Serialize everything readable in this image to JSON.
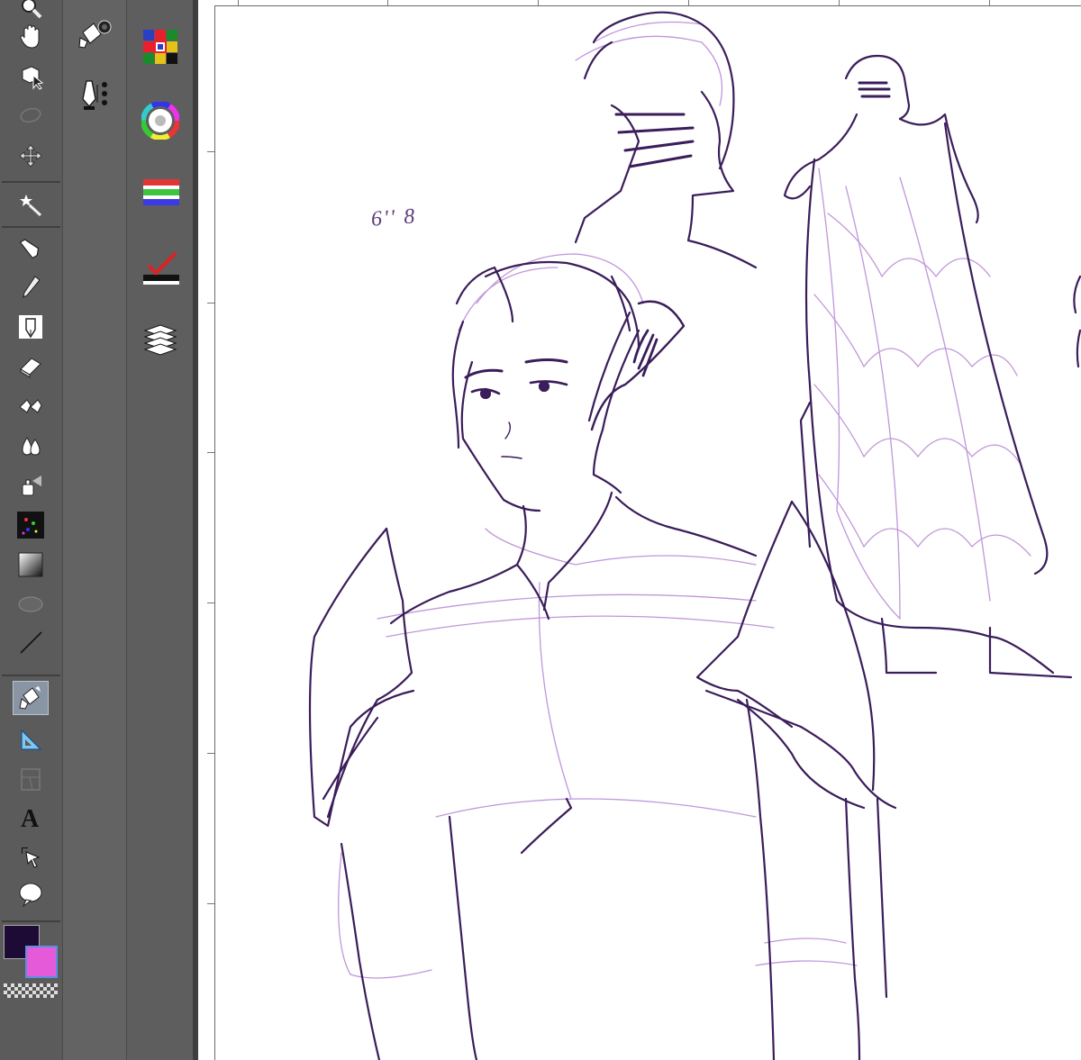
{
  "app": {
    "colors": {
      "main_color": "#1d0a35",
      "sub_color": "#e55ad9",
      "line_dark": "#3a1d5a",
      "line_light": "#b98bd6"
    }
  },
  "toolbar": {
    "tools": [
      {
        "name": "zoom-icon"
      },
      {
        "name": "hand-icon"
      },
      {
        "name": "object-select-icon"
      },
      {
        "name": "lasso-select-icon"
      },
      {
        "name": "move-layer-icon"
      },
      {
        "name": "auto-select-wand-icon"
      },
      {
        "name": "pen-icon"
      },
      {
        "name": "pencil-icon"
      },
      {
        "name": "brush-icon"
      },
      {
        "name": "eraser-icon"
      },
      {
        "name": "blend-icon"
      },
      {
        "name": "water-drop-icon"
      },
      {
        "name": "airbrush-icon"
      },
      {
        "name": "decoration-icon"
      },
      {
        "name": "gradient-icon"
      },
      {
        "name": "figure-ellipse-icon"
      },
      {
        "name": "line-icon"
      },
      {
        "name": "fill-bucket-icon",
        "active": true
      },
      {
        "name": "ruler-icon"
      },
      {
        "name": "frame-icon"
      },
      {
        "name": "text-icon"
      },
      {
        "name": "operation-arrow-icon"
      },
      {
        "name": "balloon-icon"
      }
    ]
  },
  "subtool_panel": {
    "icons": [
      "fill-settings-icon",
      "vector-pen-icon"
    ]
  },
  "palette_panel": {
    "icons": [
      "color-set-icon",
      "color-wheel-icon",
      "color-slider-icon",
      "approx-color-icon",
      "layers-icon"
    ]
  },
  "canvas": {
    "note_text": "6'' 8"
  }
}
